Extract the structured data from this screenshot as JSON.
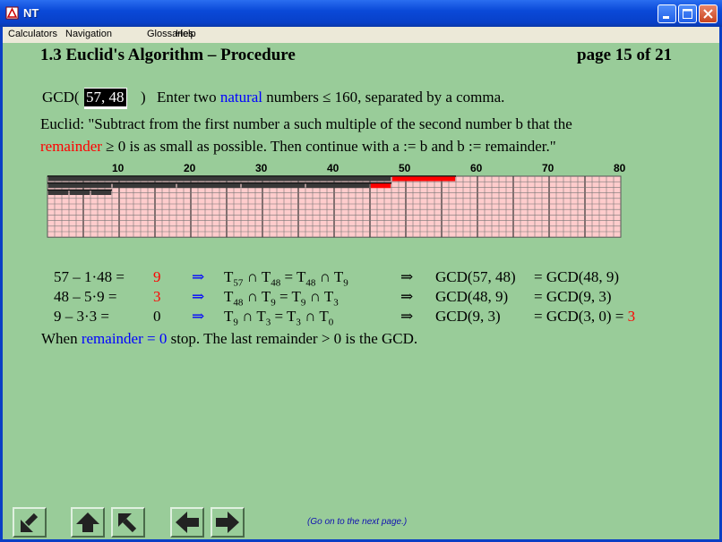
{
  "window": {
    "title": "NT"
  },
  "menu": {
    "items": [
      "Calculators",
      "Navigation",
      "Glossaries",
      "Help"
    ]
  },
  "page": {
    "heading": "1.3 Euclid's Algorithm – Procedure",
    "page_indicator": "page 15 of 21"
  },
  "gcd_input": {
    "prefix": "GCD(",
    "value": "57, 48",
    "suffix": ")",
    "hint_before": "Enter two ",
    "hint_link": "natural",
    "hint_after": " numbers ≤ 160, separated by a comma."
  },
  "euclid": {
    "line1": "Euclid: \"Subtract from the first number a such multiple of the second number b that the",
    "line2_red": "remainder",
    "line2_rest": " ≥ 0 is as small as possible. Then continue with a := b and b := remainder.\""
  },
  "grid": {
    "tick_labels": [
      "10",
      "20",
      "30",
      "40",
      "50",
      "60",
      "70",
      "80"
    ],
    "max": 80,
    "rows": [
      {
        "length": 57,
        "blocks": 1,
        "block_size": 48,
        "remainder": 9
      },
      {
        "length": 48,
        "blocks": 5,
        "block_size": 9,
        "remainder": 3
      },
      {
        "length": 9,
        "blocks": 3,
        "block_size": 3,
        "remainder": 0
      }
    ],
    "colors": {
      "block": "#383838",
      "remainder": "#ff0000",
      "cell": "#ffcccc",
      "line": "#555555"
    }
  },
  "steps": [
    {
      "eq": "57 – 1·48 =",
      "rem": "9",
      "rem_red": true,
      "arrow": "⇒",
      "t": [
        "T",
        "57",
        " ∩ T",
        "48",
        " = T",
        "48",
        " ∩ T",
        "9",
        ""
      ],
      "imp": "⇒",
      "gcd": "GCD(57, 48)",
      "eq2": "= GCD(48, 9)",
      "tail": ""
    },
    {
      "eq": "48 – 5·9 =",
      "rem": "3",
      "rem_red": true,
      "arrow": "⇒",
      "t": [
        "T",
        "48",
        " ∩ T",
        "9",
        " = T",
        "9",
        " ∩ T",
        "3",
        ""
      ],
      "imp": "⇒",
      "gcd": "GCD(48, 9)",
      "eq2": "= GCD(9, 3)",
      "tail": ""
    },
    {
      "eq": "9 – 3·3 =",
      "rem": "0",
      "rem_red": false,
      "arrow": "⇒",
      "t": [
        "T",
        "9",
        " ∩ T",
        "3",
        " = T",
        "3",
        " ∩ T",
        "0",
        ""
      ],
      "imp": "⇒",
      "gcd": "GCD(9, 3)",
      "eq2": "= GCD(3, 0) = ",
      "tail": "3"
    }
  ],
  "conclusion": {
    "before": "When ",
    "blue": "remainder = 0",
    "after": " stop. The last remainder > 0 is the GCD."
  },
  "footer": {
    "hint": "(Go on to the next page.)"
  },
  "nav_buttons": [
    "arrow-down-left-icon",
    "arrow-up-icon",
    "arrow-up-left-icon",
    "arrow-left-icon",
    "arrow-right-icon"
  ]
}
